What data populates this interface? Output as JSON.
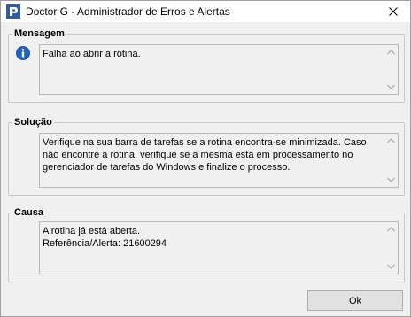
{
  "window": {
    "title": "Doctor G - Administrador de Erros e Alertas",
    "close_icon": "close-icon"
  },
  "mensagem": {
    "label": "Mensagem",
    "icon": "info-icon",
    "text": "Falha ao abrir a rotina."
  },
  "solucao": {
    "label": "Solução",
    "text": "Verifique na sua barra de tarefas se a rotina encontra-se minimizada. Caso não encontre a rotina, verifique se a mesma está em processamento no gerenciador de tarefas do Windows e finalize o processo."
  },
  "causa": {
    "label": "Causa",
    "text": "A rotina já está aberta.\nReferência/Alerta: 21600294"
  },
  "buttons": {
    "ok_label": "Ok"
  },
  "colors": {
    "accent": "#2f5d9f",
    "info_blue": "#1f63c9"
  }
}
